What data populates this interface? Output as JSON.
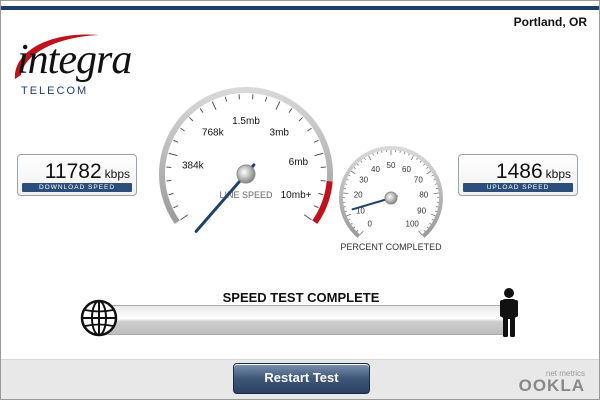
{
  "header": {
    "location": "Portland, OR"
  },
  "logo": {
    "word": "integra",
    "sub": "TELECOM"
  },
  "download": {
    "value": "11782",
    "unit": "kbps",
    "caption": "DOWNLOAD SPEED"
  },
  "upload": {
    "value": "1486",
    "unit": "kbps",
    "caption": "UPLOAD SPEED"
  },
  "line_speed_gauge": {
    "caption": "LINE SPEED",
    "ticks": [
      "384k",
      "768k",
      "1.5mb",
      "3mb",
      "6mb",
      "10mb+"
    ],
    "needle_tick_fraction": 0.2
  },
  "percent_gauge": {
    "caption": "PERCENT COMPLETED",
    "ticks": [
      "0",
      "10",
      "20",
      "30",
      "40",
      "50",
      "60",
      "70",
      "80",
      "90",
      "100"
    ],
    "needle_value": 12
  },
  "progress": {
    "title": "SPEED TEST COMPLETE"
  },
  "footer": {
    "restart_label": "Restart Test",
    "brand_small": "net metrics",
    "brand": "OOKLA"
  },
  "colors": {
    "accent": "#1c3f6e",
    "needle": "#1f3f6e",
    "redline": "#c0121a"
  },
  "icons": {
    "globe": "globe-icon",
    "person": "person-icon"
  }
}
